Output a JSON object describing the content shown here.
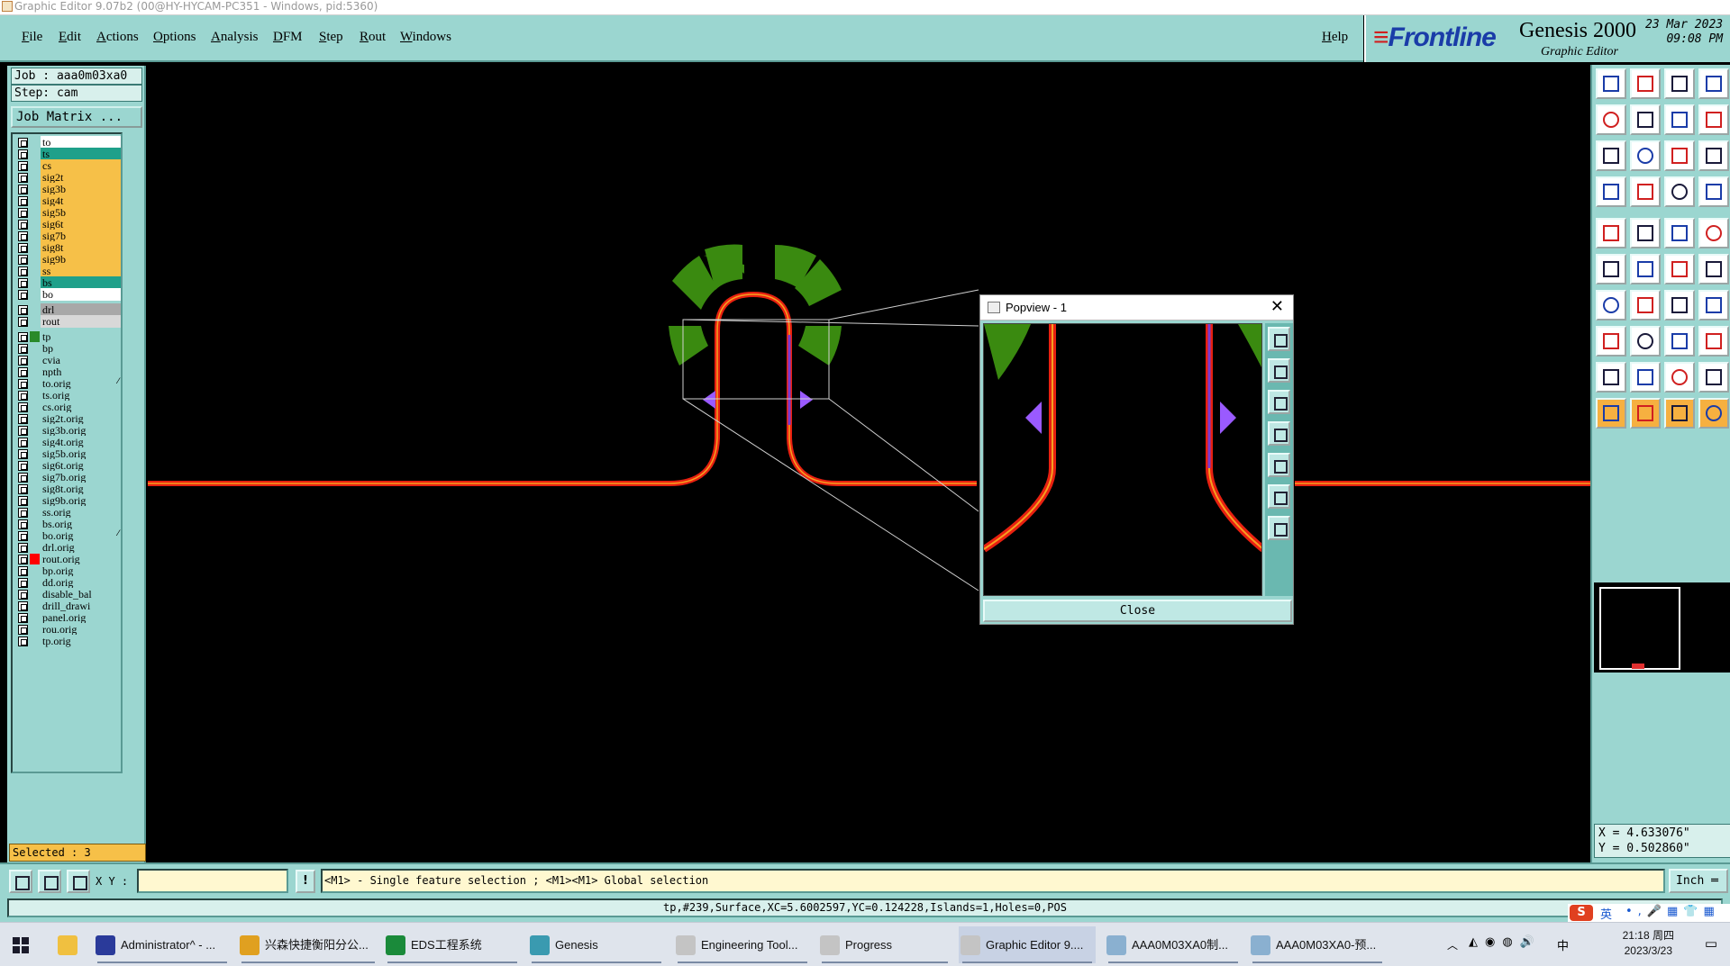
{
  "window": {
    "title": "Graphic Editor 9.07b2 (00@HY-HYCAM-PC351 - Windows, pid:5360)"
  },
  "menu": {
    "items": [
      "File",
      "Edit",
      "Actions",
      "Options",
      "Analysis",
      "DFM",
      "Step",
      "Rout",
      "Windows"
    ],
    "help": "Help"
  },
  "brand": {
    "logo": "Frontline",
    "product": "Genesis 2000",
    "subtitle": "Graphic Editor",
    "date": "23 Mar 2023",
    "time": "09:08 PM"
  },
  "job": {
    "label": "Job : aaa0m03xa0",
    "step": "Step: cam",
    "matrix_button": "Job Matrix ..."
  },
  "layers": [
    {
      "name": "to",
      "color": "#ffffff"
    },
    {
      "name": "ts",
      "color": "#1fa08a"
    },
    {
      "name": "cs",
      "color": "#f6c048"
    },
    {
      "name": "sig2t",
      "color": "#f6c048"
    },
    {
      "name": "sig3b",
      "color": "#f6c048"
    },
    {
      "name": "sig4t",
      "color": "#f6c048"
    },
    {
      "name": "sig5b",
      "color": "#f6c048"
    },
    {
      "name": "sig6t",
      "color": "#f6c048"
    },
    {
      "name": "sig7b",
      "color": "#f6c048"
    },
    {
      "name": "sig8t",
      "color": "#f6c048"
    },
    {
      "name": "sig9b",
      "color": "#f6c048"
    },
    {
      "name": "ss",
      "color": "#f6c048"
    },
    {
      "name": "bs",
      "color": "#1fa08a"
    },
    {
      "name": "bo",
      "color": "#ffffff"
    },
    {
      "name": "drl",
      "color": "#a8a8a8"
    },
    {
      "name": "rout",
      "color": "#d8d8d8"
    },
    {
      "name": "tp",
      "color": "#9bd6d0",
      "work": true
    },
    {
      "name": "bp",
      "color": "#9bd6d0"
    },
    {
      "name": "cvia",
      "color": "#9bd6d0"
    },
    {
      "name": "npth",
      "color": "#9bd6d0"
    },
    {
      "name": "to.orig",
      "color": "#9bd6d0",
      "mark": "⁄"
    },
    {
      "name": "ts.orig",
      "color": "#9bd6d0"
    },
    {
      "name": "cs.orig",
      "color": "#9bd6d0"
    },
    {
      "name": "sig2t.orig",
      "color": "#9bd6d0"
    },
    {
      "name": "sig3b.orig",
      "color": "#9bd6d0"
    },
    {
      "name": "sig4t.orig",
      "color": "#9bd6d0"
    },
    {
      "name": "sig5b.orig",
      "color": "#9bd6d0"
    },
    {
      "name": "sig6t.orig",
      "color": "#9bd6d0"
    },
    {
      "name": "sig7b.orig",
      "color": "#9bd6d0"
    },
    {
      "name": "sig8t.orig",
      "color": "#9bd6d0"
    },
    {
      "name": "sig9b.orig",
      "color": "#9bd6d0"
    },
    {
      "name": "ss.orig",
      "color": "#9bd6d0"
    },
    {
      "name": "bs.orig",
      "color": "#9bd6d0"
    },
    {
      "name": "bo.orig",
      "color": "#9bd6d0",
      "mark": "⁄"
    },
    {
      "name": "drl.orig",
      "color": "#9bd6d0"
    },
    {
      "name": "rout.orig",
      "color": "#9bd6d0",
      "red": true
    },
    {
      "name": "bp.orig",
      "color": "#9bd6d0"
    },
    {
      "name": "dd.orig",
      "color": "#9bd6d0"
    },
    {
      "name": "disable_bal",
      "color": "#9bd6d0"
    },
    {
      "name": "drill_drawi",
      "color": "#9bd6d0"
    },
    {
      "name": "panel.orig",
      "color": "#9bd6d0"
    },
    {
      "name": "rou.orig",
      "color": "#9bd6d0"
    },
    {
      "name": "tp.orig",
      "color": "#9bd6d0"
    }
  ],
  "selected": "Selected : 3",
  "popview": {
    "title": "Popview - 1",
    "close_label": "Close"
  },
  "coords": {
    "x": "X = 4.633076\"",
    "y": "Y = 0.502860\""
  },
  "command": {
    "xy_label": "X Y :",
    "xy_value": "",
    "info_button": "!",
    "prompt": "<M1> - Single feature selection ; <M1><M1> Global selection",
    "unit": "Inch"
  },
  "status": "tp,#239,Surface,XC=5.6002597,YC=0.124228,Islands=1,Holes=0,POS",
  "ime": {
    "brand": "S",
    "lang": "英"
  },
  "taskbar": {
    "items": [
      {
        "label": "Administrator^ - ...",
        "color": "#2a3a9a"
      },
      {
        "label": "兴森快捷衡阳分公...",
        "color": "#e0a020"
      },
      {
        "label": "EDS工程系统",
        "color": "#1a8a3a"
      },
      {
        "label": "Genesis",
        "color": "#3a9ab0"
      },
      {
        "label": "Engineering Tool...",
        "color": "#c4c4c4"
      },
      {
        "label": "Progress",
        "color": "#c4c4c4"
      },
      {
        "label": "Graphic Editor 9....",
        "color": "#c4c4c4"
      },
      {
        "label": "AAA0M03XA0制...",
        "color": "#8ab0d0"
      },
      {
        "label": "AAA0M03XA0-预...",
        "color": "#8ab0d0"
      }
    ],
    "tray_lang": "中",
    "clock_time": "21:18 周四",
    "clock_date": "2023/3/23"
  },
  "colors": {
    "panel": "#9bd6d0",
    "trace": "#e82010",
    "trace_core": "#f6a020",
    "pad": "#3a8a10",
    "marker": "#9a5aff",
    "highlight": "#f6c048"
  }
}
